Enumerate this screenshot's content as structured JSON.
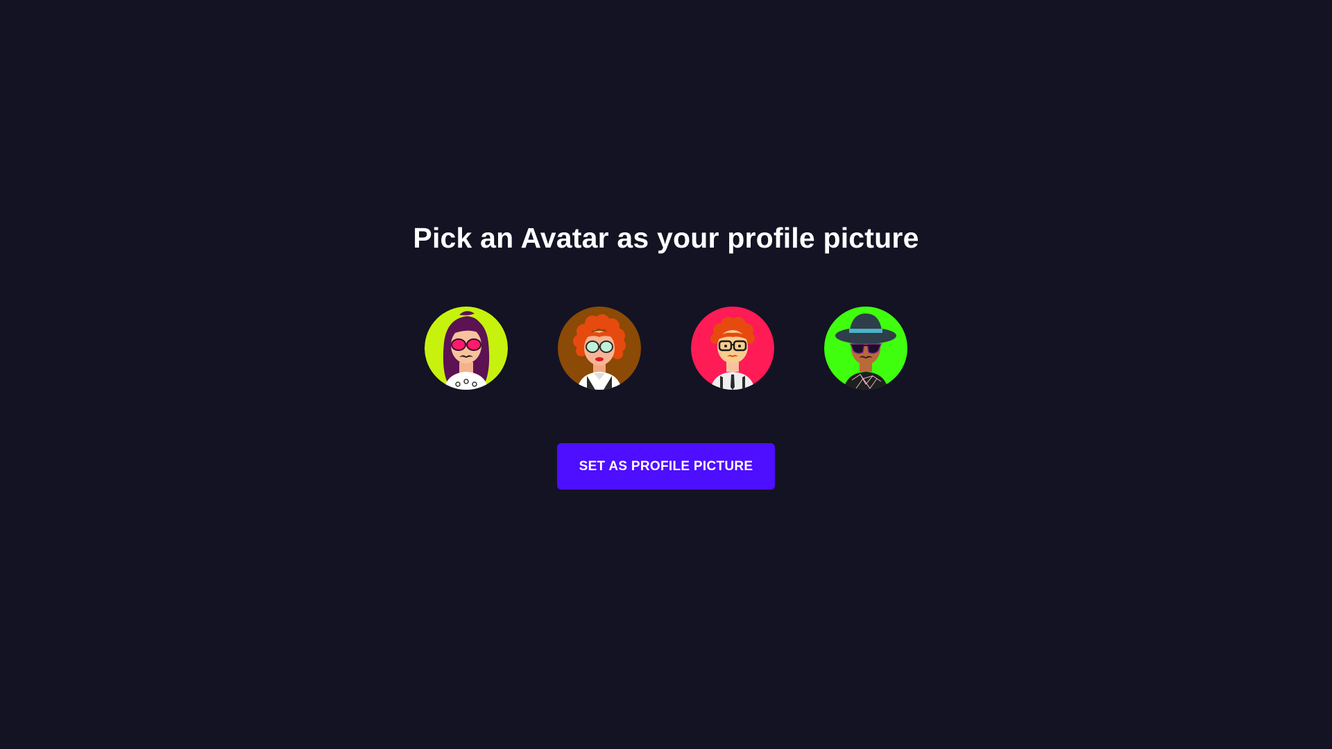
{
  "page": {
    "title": "Pick an Avatar as your profile picture",
    "button_label": "SET AS PROFILE PICTURE"
  },
  "avatars": [
    {
      "name": "avatar-1",
      "background": "#c6f20e",
      "hair": "#5c1253",
      "glasses": "pink-glasses"
    },
    {
      "name": "avatar-2",
      "background": "#8b4a05",
      "hair": "#e64a0f",
      "glasses": "mint-glasses"
    },
    {
      "name": "avatar-3",
      "background": "#ff1b56",
      "hair": "#e64a0f",
      "glasses": "black-glasses"
    },
    {
      "name": "avatar-4",
      "background": "#3fff0f",
      "hair": "#2f3e4a",
      "glasses": "sunglasses"
    }
  ],
  "colors": {
    "background": "#131324",
    "accent": "#4e0eff",
    "text": "#ffffff"
  }
}
